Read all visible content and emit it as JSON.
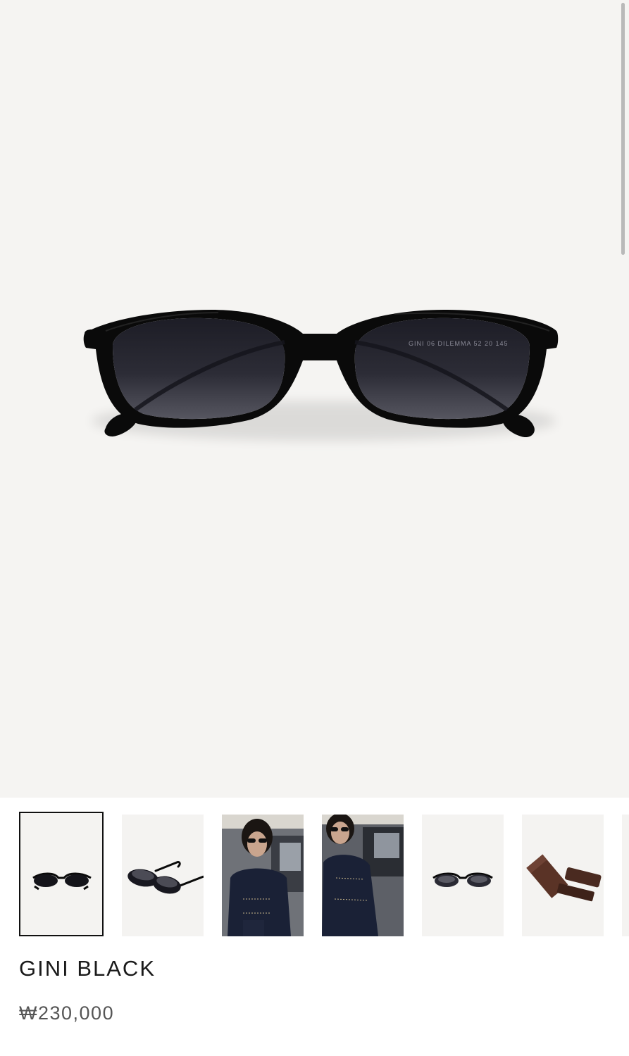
{
  "product": {
    "name": "GINI BLACK",
    "price": "₩230,000",
    "lens_engraving": "GINI 06 DILEMMA 52 20 145"
  },
  "gallery": {
    "selected_index": 0,
    "thumbnails": [
      {
        "type": "product-front"
      },
      {
        "type": "product-side"
      },
      {
        "type": "model-lifestyle"
      },
      {
        "type": "model-closeup"
      },
      {
        "type": "product-front-alt"
      },
      {
        "type": "case-packaging"
      }
    ]
  },
  "colors": {
    "background": "#f5f4f2",
    "frame": "#0a0a0a",
    "lens": "#2a2a35",
    "case": "#4a2a20"
  }
}
